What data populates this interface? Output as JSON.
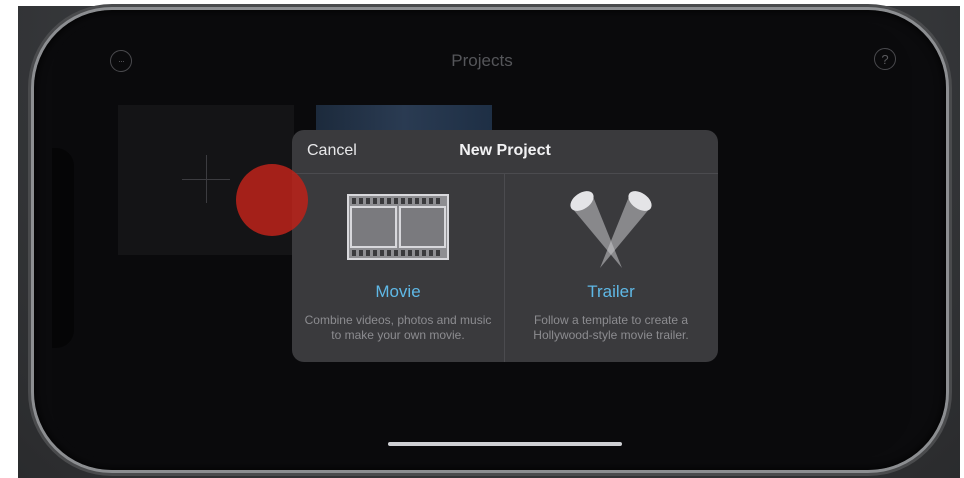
{
  "header": {
    "title": "Projects",
    "more_icon": "ellipsis-circle-icon",
    "help_icon": "question-circle-icon",
    "more_glyph": "···",
    "help_glyph": "?"
  },
  "new_project_dialog": {
    "title": "New Project",
    "cancel_label": "Cancel",
    "options": [
      {
        "label": "Movie",
        "description": "Combine videos, photos and music to make your own movie.",
        "icon": "film-strip-icon"
      },
      {
        "label": "Trailer",
        "description": "Follow a template to create a Hollywood-style movie trailer.",
        "icon": "spotlights-icon"
      }
    ]
  },
  "colors": {
    "accent": "#5fb8e6",
    "dialog_bg": "#3a3a3d",
    "touch_indicator": "#b8221a"
  }
}
